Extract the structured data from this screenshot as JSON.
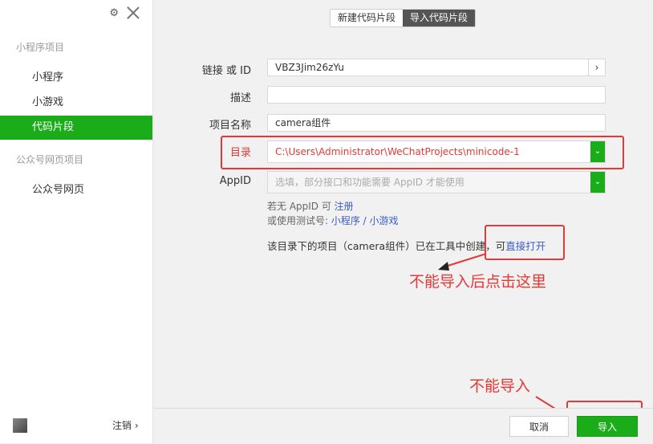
{
  "sidebar": {
    "section1_title": "小程序项目",
    "items1": [
      {
        "label": "小程序"
      },
      {
        "label": "小游戏"
      },
      {
        "label": "代码片段"
      }
    ],
    "section2_title": "公众号网页项目",
    "items2": [
      {
        "label": "公众号网页"
      }
    ],
    "logout_label": "注销 ›"
  },
  "tabs": [
    {
      "label": "新建代码片段",
      "active": false
    },
    {
      "label": "导入代码片段",
      "active": true
    }
  ],
  "form": {
    "link_label": "链接 或 ID",
    "link_value": "VBZ3Jim26zYu",
    "desc_label": "描述",
    "desc_value": "",
    "name_label": "项目名称",
    "name_value": "camera组件",
    "dir_label": "目录",
    "dir_value": "C:\\Users\\Administrator\\WeChatProjects\\minicode-1",
    "appid_label": "AppID",
    "appid_placeholder": "选填，部分接口和功能需要 AppID 才能使用"
  },
  "hints": {
    "no_appid_prefix": "若无 AppID 可 ",
    "register_link": "注册",
    "test_prefix": "或使用测试号: ",
    "test_link": "小程序 / 小游戏"
  },
  "message": {
    "text": "该目录下的项目（camera组件）已在工具中创建，可",
    "open_link": "直接打开"
  },
  "annotations": {
    "note1": "不能导入后点击这里",
    "note2": "不能导入"
  },
  "footer": {
    "cancel_label": "取消",
    "import_label": "导入"
  },
  "colors": {
    "accent_green": "#1aad19",
    "annotation_red": "#e53935",
    "link_blue": "#3a5cc7"
  }
}
